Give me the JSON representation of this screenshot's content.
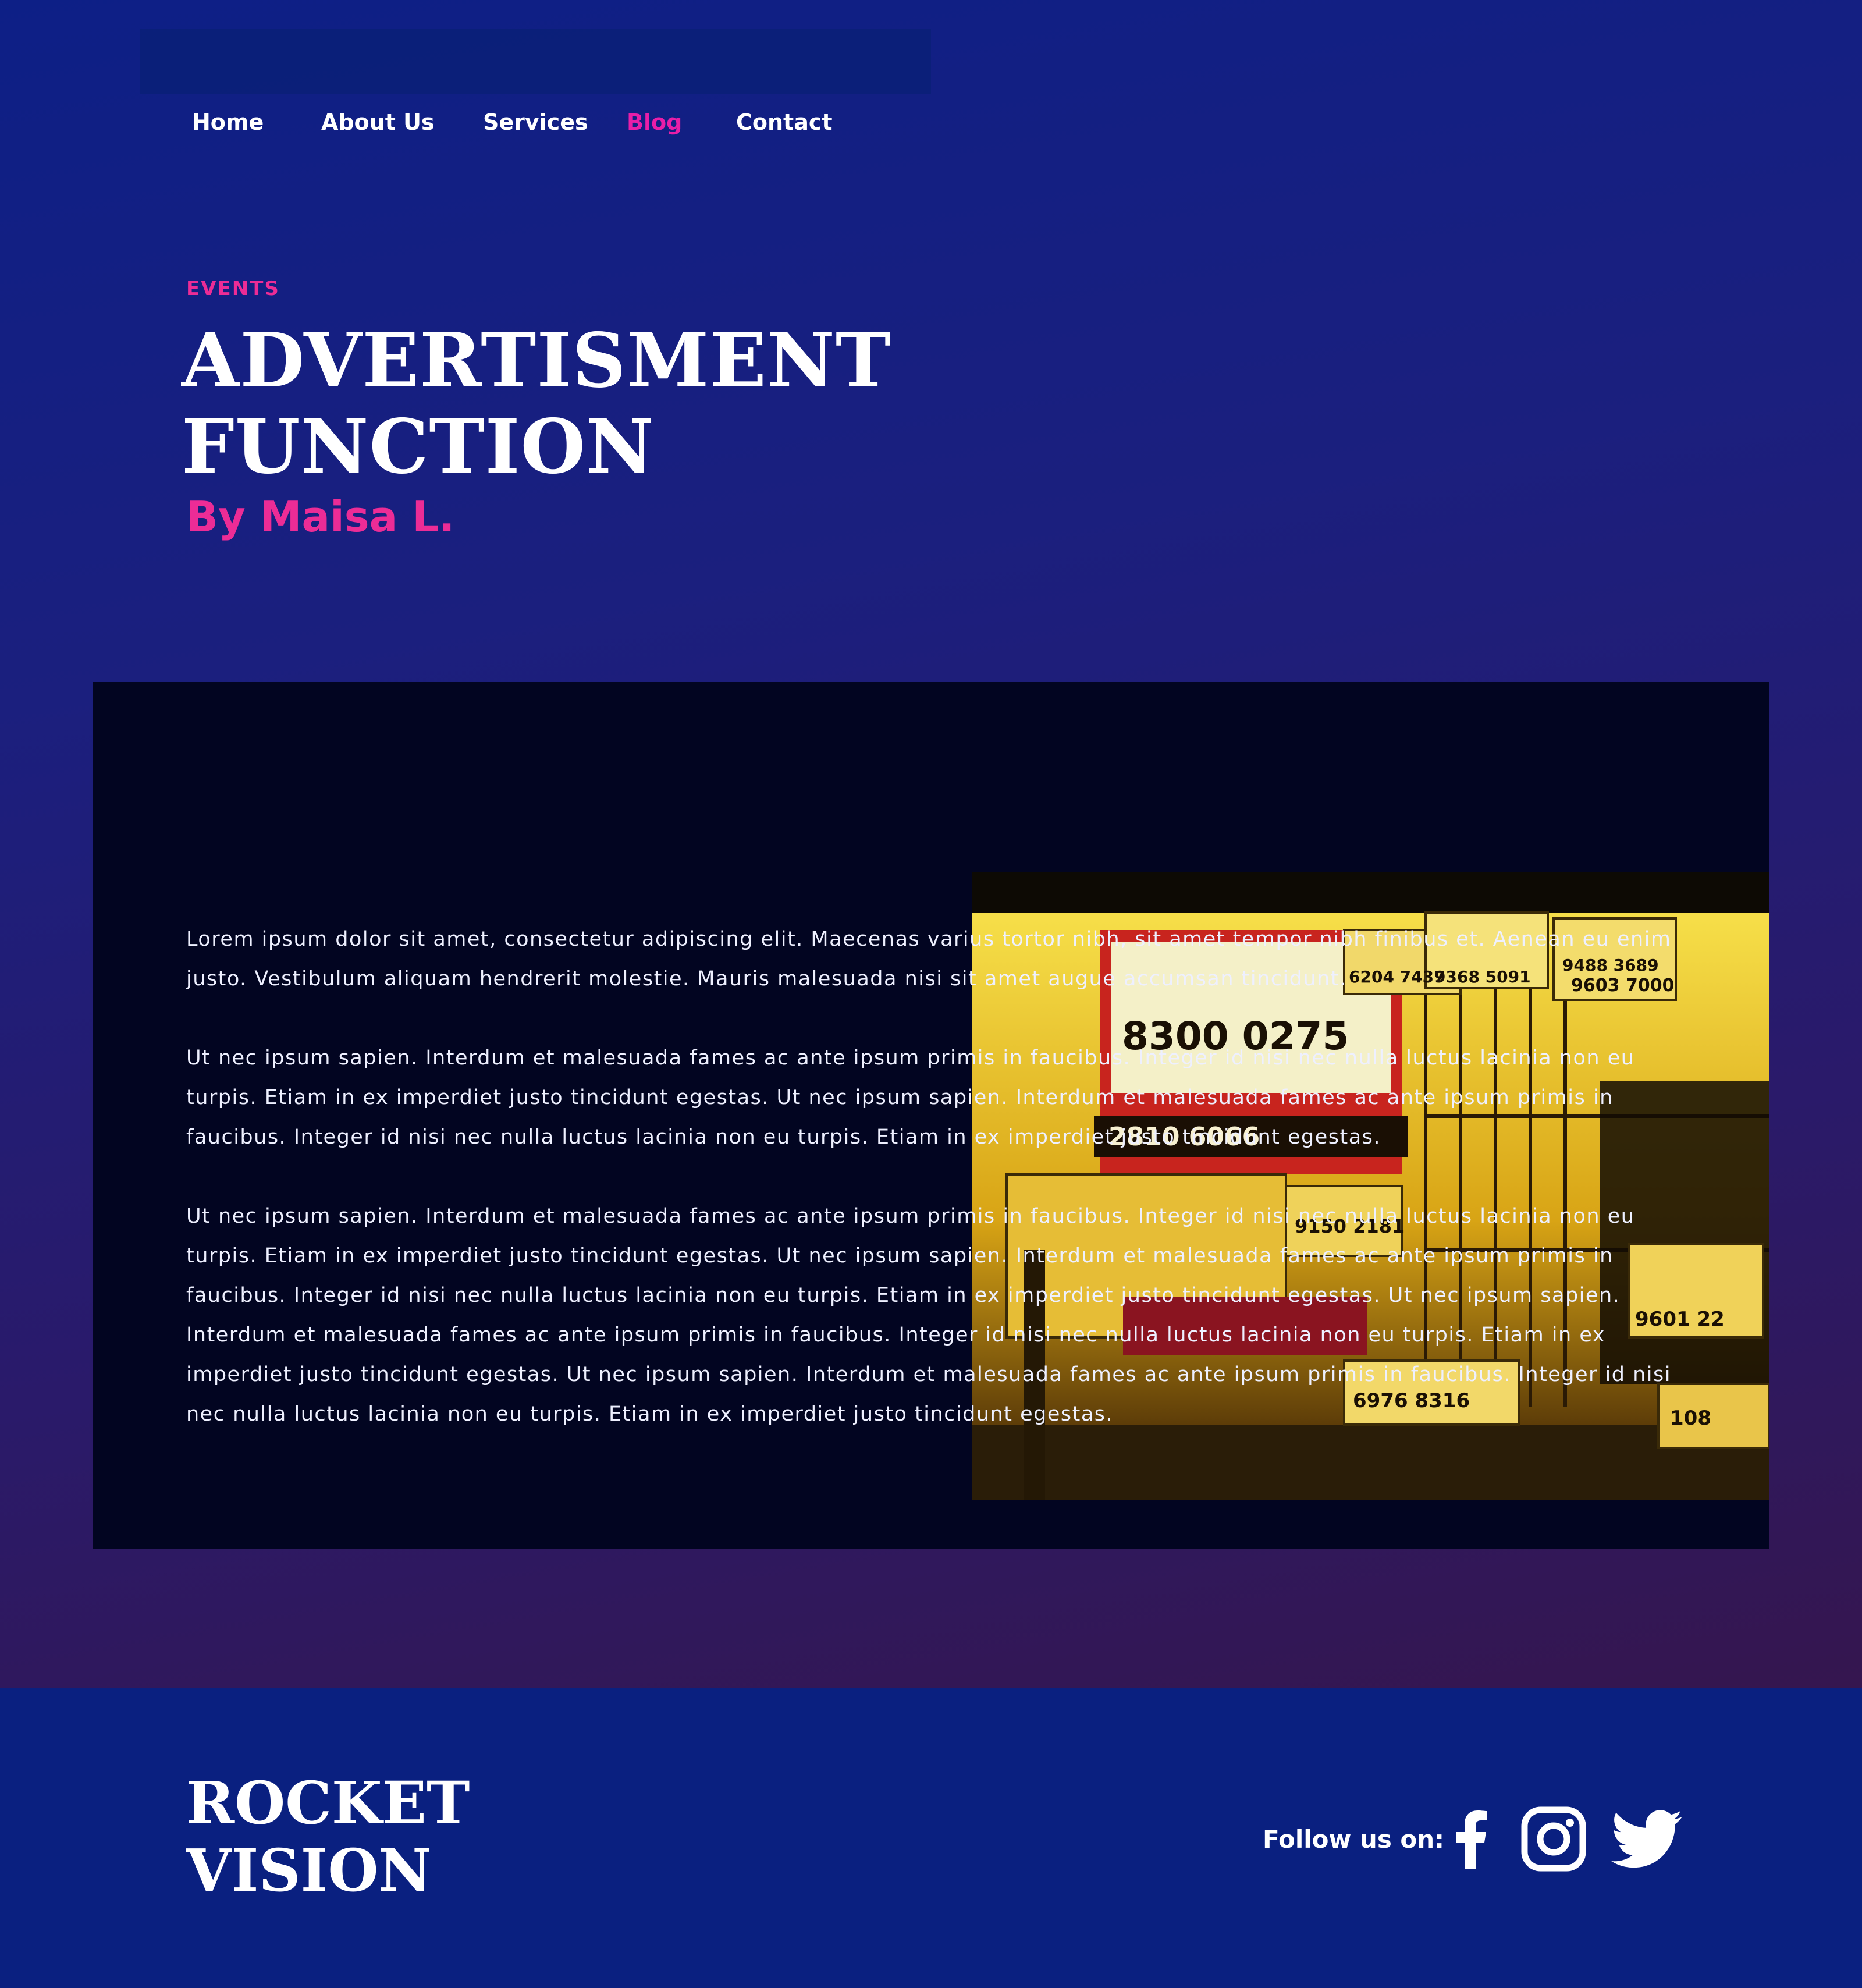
{
  "nav": {
    "items": [
      {
        "label": "Home"
      },
      {
        "label": "About Us"
      },
      {
        "label": "Services"
      },
      {
        "label": "Blog"
      },
      {
        "label": "Contact"
      }
    ],
    "active": "Blog",
    "active_color": "#e91ea8"
  },
  "hero": {
    "category": "EVENTS",
    "title": "ADVERTISMENT FUNCTION",
    "author": "By Maisa L.",
    "accent_color": "#ec2c96",
    "image_sign_numbers": [
      "6204 7437",
      "9368 5091",
      "9488 3689",
      "9603 7000",
      "8300 0275",
      "2810 6066",
      "9150 2181",
      "9601 22",
      "6976 8316",
      "108"
    ]
  },
  "article": {
    "paragraphs": [
      "Lorem ipsum dolor sit amet, consectetur adipiscing elit. Maecenas varius tortor nibh, sit amet tempor nibh finibus et. Aenean eu enim justo. Vestibulum aliquam hendrerit molestie. Mauris malesuada nisi sit amet augue accumsan tincidunt.",
      " Ut nec ipsum sapien. Interdum et malesuada fames ac ante ipsum primis in faucibus. Integer id nisi nec nulla luctus lacinia non eu turpis. Etiam in ex imperdiet justo tincidunt egestas.  Ut nec ipsum sapien. Interdum et malesuada fames ac ante ipsum primis in faucibus. Integer id nisi nec nulla luctus lacinia non eu turpis. Etiam in ex imperdiet justo tincidunt egestas.",
      " Ut nec ipsum sapien. Interdum et malesuada fames ac ante ipsum primis in faucibus. Integer id nisi nec nulla luctus lacinia non eu turpis. Etiam in ex imperdiet justo tincidunt egestas.  Ut nec ipsum sapien. Interdum et malesuada fames ac ante ipsum primis in faucibus. Integer id nisi nec nulla luctus lacinia non eu turpis. Etiam in ex imperdiet justo tincidunt egestas.  Ut nec ipsum sapien. Interdum et malesuada fames ac ante ipsum primis in faucibus. Integer id nisi nec nulla luctus lacinia non eu turpis. Etiam in ex imperdiet justo tincidunt egestas.  Ut nec ipsum sapien. Interdum et malesuada fames ac ante ipsum primis in faucibus. Integer id nisi nec nulla luctus lacinia non eu turpis. Etiam in ex imperdiet justo tincidunt egestas."
    ]
  },
  "footer": {
    "brand": "ROCKET VISION",
    "follow_label": "Follow us on:",
    "social": [
      {
        "icon": "facebook-icon"
      },
      {
        "icon": "instagram-icon"
      },
      {
        "icon": "twitter-icon"
      }
    ]
  },
  "colors": {
    "page_bg": "#0d1f86",
    "footer_bg": "#0a2080",
    "content_bg": "#020521",
    "text": "#ffffff"
  }
}
